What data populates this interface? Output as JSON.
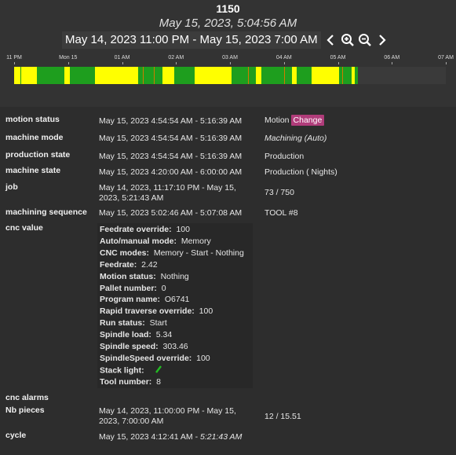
{
  "header": {
    "title": "1150",
    "current_time": "May 15, 2023, 5:04:56 AM",
    "range": "May 14, 2023 11:00 PM - May 15, 2023 7:00 AM"
  },
  "timeline": {
    "ticks": [
      "11 PM",
      "Mon 15",
      "01 AM",
      "02 AM",
      "03 AM",
      "04 AM",
      "05 AM",
      "06 AM",
      "07 AM"
    ],
    "colors": {
      "green": "#1e9e1e",
      "yellow": "#ffff00",
      "orange": "#d07a00",
      "empty": "#3a3a3a"
    },
    "segments": [
      {
        "start": "23:00",
        "end": "23:07",
        "state": "yellow"
      },
      {
        "start": "23:07",
        "end": "23:08",
        "state": "green"
      },
      {
        "start": "23:08",
        "end": "23:25",
        "state": "yellow"
      },
      {
        "start": "23:25",
        "end": "23:56",
        "state": "green"
      },
      {
        "start": "23:56",
        "end": "00:02",
        "state": "yellow"
      },
      {
        "start": "00:02",
        "end": "00:30",
        "state": "green"
      },
      {
        "start": "00:30",
        "end": "01:18",
        "state": "yellow"
      },
      {
        "start": "01:18",
        "end": "01:23",
        "state": "green"
      },
      {
        "start": "01:23",
        "end": "01:24",
        "state": "orange"
      },
      {
        "start": "01:24",
        "end": "01:35",
        "state": "green"
      },
      {
        "start": "01:35",
        "end": "01:36",
        "state": "orange"
      },
      {
        "start": "01:36",
        "end": "01:45",
        "state": "green"
      },
      {
        "start": "01:45",
        "end": "01:58",
        "state": "yellow"
      },
      {
        "start": "01:58",
        "end": "02:21",
        "state": "green"
      },
      {
        "start": "02:21",
        "end": "03:02",
        "state": "yellow"
      },
      {
        "start": "03:02",
        "end": "03:20",
        "state": "green"
      },
      {
        "start": "03:20",
        "end": "03:21",
        "state": "orange"
      },
      {
        "start": "03:21",
        "end": "03:29",
        "state": "green"
      },
      {
        "start": "03:29",
        "end": "03:35",
        "state": "yellow"
      },
      {
        "start": "03:35",
        "end": "04:00",
        "state": "green"
      },
      {
        "start": "04:00",
        "end": "04:01",
        "state": "orange"
      },
      {
        "start": "04:01",
        "end": "04:09",
        "state": "green"
      },
      {
        "start": "04:09",
        "end": "04:14",
        "state": "yellow"
      },
      {
        "start": "04:14",
        "end": "04:31",
        "state": "green"
      },
      {
        "start": "04:31",
        "end": "05:01",
        "state": "yellow"
      },
      {
        "start": "05:01",
        "end": "05:05",
        "state": "green"
      },
      {
        "start": "05:05",
        "end": "05:06",
        "state": "orange"
      },
      {
        "start": "05:06",
        "end": "05:15",
        "state": "green"
      },
      {
        "start": "05:15",
        "end": "05:19",
        "state": "yellow"
      },
      {
        "start": "05:19",
        "end": "05:22",
        "state": "green"
      }
    ]
  },
  "rows": {
    "motion_status": {
      "label": "motion status",
      "time": "May 15, 2023 4:54:54 AM - 5:16:39 AM",
      "value": "Motion",
      "button": "Change"
    },
    "machine_mode": {
      "label": "machine mode",
      "time": "May 15, 2023 4:54:54 AM - 5:16:39 AM",
      "value": "Machining (Auto)"
    },
    "production_state": {
      "label": "production state",
      "time": "May 15, 2023 4:54:54 AM - 5:16:39 AM",
      "value": "Production"
    },
    "machine_state": {
      "label": "machine state",
      "time": "May 15, 2023 4:20:00 AM - 6:00:00 AM",
      "value": "Production ( Nights)"
    },
    "job": {
      "label": "job",
      "time_line1": "May 14, 2023, 11:17:10 PM - May 15,",
      "time_line2": "2023, 5:21:43 AM",
      "value": "73 / 750"
    },
    "machining_sequence": {
      "label": "machining sequence",
      "time": "May 15, 2023 5:02:46 AM - 5:07:08 AM",
      "value": "TOOL #8"
    },
    "cnc_value": {
      "label": "cnc value"
    },
    "cnc_alarms": {
      "label": "cnc alarms"
    },
    "nb_pieces": {
      "label": "Nb pieces",
      "time_line1": "May 14, 2023, 11:00:00 PM - May 15,",
      "time_line2": "2023, 7:00:00 AM",
      "value": "12 / 15.51"
    },
    "cycle": {
      "label": "cycle",
      "time_start": "May 15, 2023 4:12:41 AM - ",
      "time_end": "5:21:43 AM"
    }
  },
  "cnc": [
    {
      "key": "Feedrate override:",
      "value": "100"
    },
    {
      "key": "Auto/manual mode:",
      "value": "Memory"
    },
    {
      "key": "CNC modes:",
      "value": "Memory - Start - Nothing"
    },
    {
      "key": "Feedrate:",
      "value": "2.42"
    },
    {
      "key": "Motion status:",
      "value": "Nothing"
    },
    {
      "key": "Pallet number:",
      "value": "0"
    },
    {
      "key": "Program name:",
      "value": "O6741"
    },
    {
      "key": "Rapid traverse override:",
      "value": "100"
    },
    {
      "key": "Run status:",
      "value": "Start"
    },
    {
      "key": "Spindle load:",
      "value": "5.34"
    },
    {
      "key": "Spindle speed:",
      "value": "303.46"
    },
    {
      "key": "SpindleSpeed override:",
      "value": "100"
    },
    {
      "key": "Stack light:",
      "value": ""
    },
    {
      "key": "Tool number:",
      "value": "8"
    }
  ],
  "stack_light_color": "#22bb22",
  "change_button_color": "#b03c7a"
}
